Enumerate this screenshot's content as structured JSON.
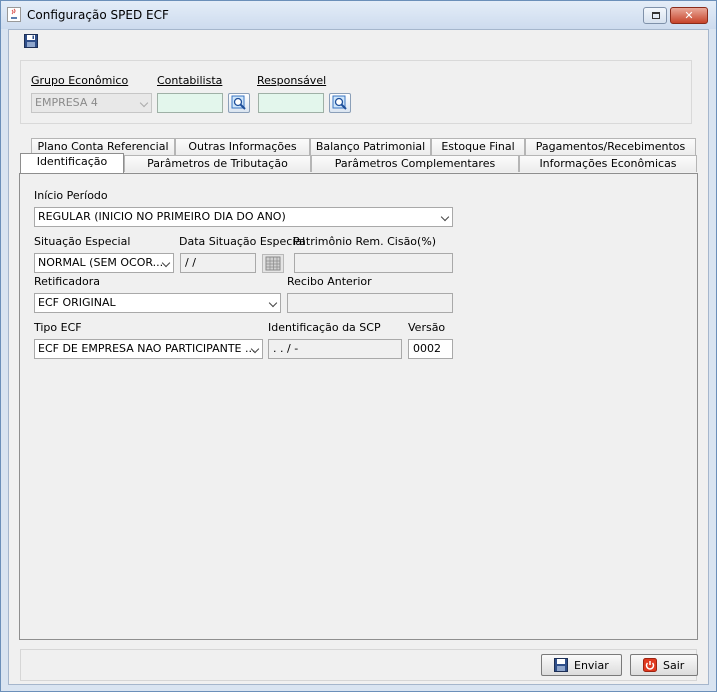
{
  "window": {
    "title": "Configuração SPED ECF",
    "controls": [
      "restore",
      "close"
    ]
  },
  "toolbar": {
    "save_icon": "floppy-disk-icon"
  },
  "header": {
    "grupo_label": "Grupo Econômico",
    "grupo_value": "EMPRESA 4",
    "contabilista_label": "Contabilista",
    "contabilista_value": "",
    "responsavel_label": "Responsável",
    "responsavel_value": "",
    "lookup_icon": "search-icon"
  },
  "tabs": {
    "row1": [
      "Plano Conta Referencial",
      "Outras Informações",
      "Balanço Patrimonial",
      "Estoque Final",
      "Pagamentos/Recebimentos"
    ],
    "row2": [
      "Identificação",
      "Parâmetros de Tributação",
      "Parâmetros Complementares",
      "Informações Econômicas"
    ],
    "active": "Identificação"
  },
  "form": {
    "inicio_label": "Início Período",
    "inicio_value": "REGULAR (INICIO NO PRIMEIRO DIA DO ANO)",
    "situacao_label": "Situação Especial",
    "situacao_value": "NORMAL (SEM OCOR...",
    "data_situacao_label": "Data Situação Especial",
    "data_situacao_value": " / /",
    "patrimonio_label": "Patrimônio Rem. Cisão(%)",
    "patrimonio_value": "",
    "retificadora_label": "Retificadora",
    "retificadora_value": "ECF ORIGINAL",
    "recibo_label": "Recibo Anterior",
    "recibo_value": "",
    "tipo_label": "Tipo ECF",
    "tipo_value": "ECF DE EMPRESA NAO PARTICIPANTE ...",
    "scp_label": "Identificação da SCP",
    "scp_value": " .  .  /   -",
    "versao_label": "Versão",
    "versao_value": "0002"
  },
  "actions": {
    "enviar_label": "Enviar",
    "sair_label": "Sair"
  },
  "colors": {
    "title_bar": "#cddbee",
    "field_green": "#e3f6ec",
    "sair_icon": "#e0391f"
  }
}
